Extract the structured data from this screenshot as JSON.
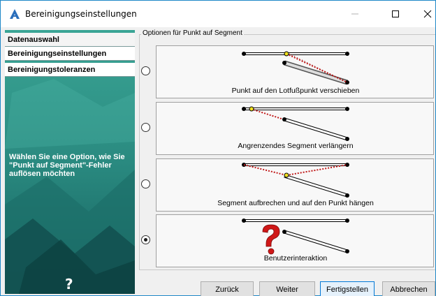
{
  "window": {
    "title": "Bereinigungseinstellungen"
  },
  "sidebar": {
    "items": [
      {
        "label": "Datenauswahl"
      },
      {
        "label": "Bereinigungseinstellungen"
      },
      {
        "label": "Bereinigungstoleranzen"
      }
    ],
    "hint": "Wählen Sie eine Option, wie Sie \"Punkt auf Segment\"-Fehler auflösen möchten",
    "help_label": "?"
  },
  "group": {
    "label": "Optionen für Punkt auf Segment"
  },
  "options": [
    {
      "caption": "Punkt auf den Lotfußpunkt verschieben",
      "selected": false
    },
    {
      "caption": "Angrenzendes Segment verlängern",
      "selected": false
    },
    {
      "caption": "Segment aufbrechen und auf den Punkt hängen",
      "selected": false
    },
    {
      "caption": "Benutzerinteraktion",
      "selected": true
    }
  ],
  "buttons": {
    "back": "Zurück",
    "next": "Weiter",
    "finish": "Fertigstellen",
    "cancel": "Abbrechen"
  },
  "colors": {
    "sidebar": "#2b8f86",
    "accent": "#0078d7",
    "error_marker": "#c01818"
  }
}
